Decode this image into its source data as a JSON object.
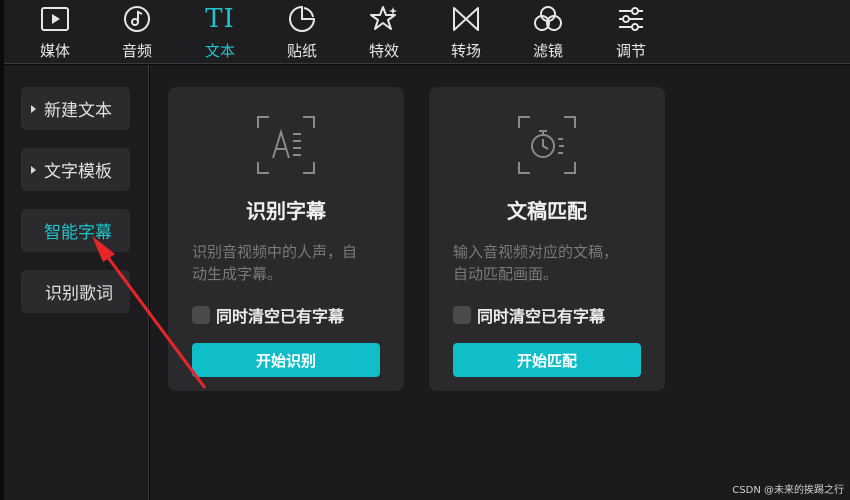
{
  "toolbar": {
    "tabs": [
      {
        "label": "媒体",
        "icon": "media-play-icon"
      },
      {
        "label": "音频",
        "icon": "music-note-icon"
      },
      {
        "label": "文本",
        "icon": "text-ti-icon",
        "icon_text": "TI",
        "active": true
      },
      {
        "label": "贴纸",
        "icon": "sticker-icon"
      },
      {
        "label": "特效",
        "icon": "sparkle-star-icon"
      },
      {
        "label": "转场",
        "icon": "bowtie-transition-icon"
      },
      {
        "label": "滤镜",
        "icon": "filter-circles-icon"
      },
      {
        "label": "调节",
        "icon": "sliders-adjust-icon"
      }
    ]
  },
  "sidebar": {
    "items": [
      {
        "label": "新建文本",
        "expandable": true
      },
      {
        "label": "文字模板",
        "expandable": true
      },
      {
        "label": "智能字幕",
        "active": true
      },
      {
        "label": "识别歌词"
      }
    ]
  },
  "cards": [
    {
      "icon": "subtitle-recognition-icon",
      "title": "识别字幕",
      "desc_line1": "识别音视频中的人声，自",
      "desc_line2": "动生成字幕。",
      "option": "同时清空已有字幕",
      "button": "开始识别"
    },
    {
      "icon": "timer-match-icon",
      "title": "文稿匹配",
      "desc_line1": "输入音视频对应的文稿，",
      "desc_line2": "自动匹配画面。",
      "option": "同时清空已有字幕",
      "button": "开始匹配"
    }
  ],
  "watermark": "CSDN @未来的挨踢之行",
  "colors": {
    "accent": "#20c4cc",
    "button": "#0fbec8",
    "arrow": "#e8262a"
  }
}
